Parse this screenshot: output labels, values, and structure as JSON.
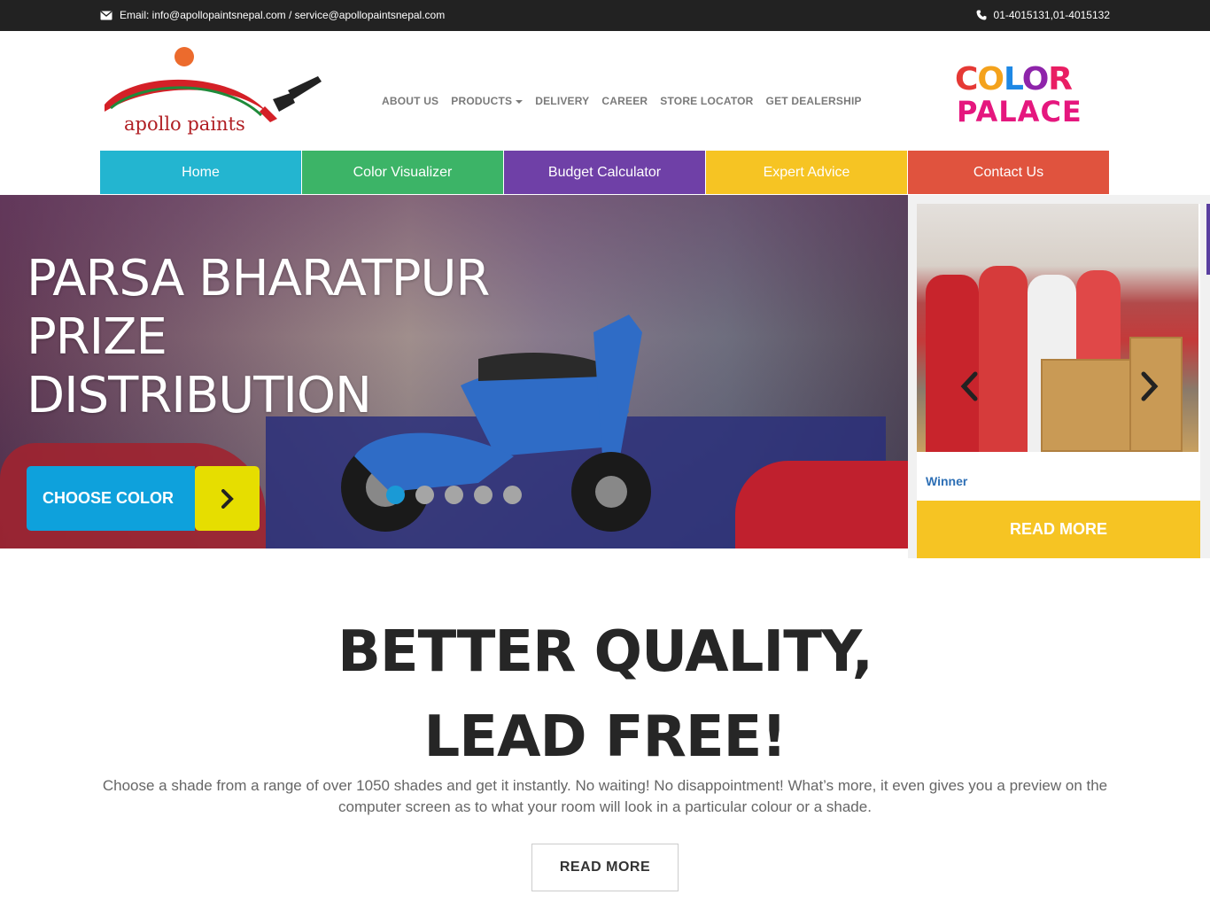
{
  "topbar": {
    "email_text": "Email: info@apollopaintsnepal.com / service@apollopaintsnepal.com",
    "phone_text": "01-4015131,01-4015132",
    "email_icon": "envelope-icon",
    "phone_icon": "phone-icon"
  },
  "header": {
    "logo_text": "apollo paints",
    "nav": [
      "ABOUT US",
      "PRODUCTS",
      "DELIVERY",
      "CAREER",
      "STORE LOCATOR",
      "GET DEALERSHIP"
    ],
    "partner_logo_line1": "COLOR",
    "partner_logo_line2": "PALACE"
  },
  "tabs": [
    {
      "label": "Home",
      "color": "#23b5d0"
    },
    {
      "label": "Color Visualizer",
      "color": "#3cb467"
    },
    {
      "label": "Budget Calculator",
      "color": "#6f40a7"
    },
    {
      "label": "Expert Advice",
      "color": "#f6c423"
    },
    {
      "label": "Contact Us",
      "color": "#e0533e"
    }
  ],
  "slider": {
    "title_lines": [
      "PARSA BHARATPUR",
      "PRIZE",
      "DISTRIBUTION"
    ],
    "cta_label": "CHOOSE COLOR",
    "slide_count": 5,
    "active_slide": 1
  },
  "news": {
    "caption": "Winner",
    "read_more": "READ MORE"
  },
  "main": {
    "headline_line1": "BETTER QUALITY,",
    "headline_line2": "LEAD FREE!",
    "description": "Choose a shade from a range of over 1050 shades and get it instantly. No waiting! No disappointment! What’s more, it even gives you a preview on the computer screen as to what your room will look in a particular colour or a shade.",
    "read_more": "READ MORE"
  },
  "colors": {
    "topbar_bg": "#222222",
    "accent_blue": "#0ea1dc",
    "accent_yellow": "#e6de00",
    "news_yellow": "#f6c423"
  }
}
